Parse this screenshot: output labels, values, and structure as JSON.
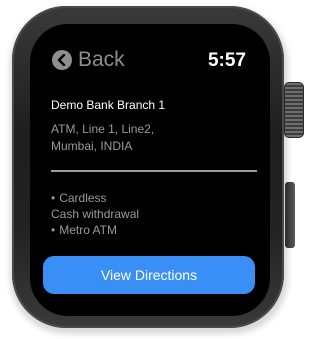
{
  "header": {
    "back_label": "Back",
    "time": "5:57"
  },
  "branch": {
    "name": "Demo Bank Branch 1",
    "address_line_1": "ATM, Line 1, Line2,",
    "address_line_2": "Mumbai, INDIA"
  },
  "features": [
    {
      "bullet": "•",
      "lines": [
        "Cardless",
        "Cash withdrawal"
      ]
    },
    {
      "bullet": "•",
      "lines": [
        "Metro ATM"
      ]
    }
  ],
  "actions": {
    "directions_label": "View Directions"
  },
  "colors": {
    "accent": "#3a8ff7",
    "screen": "#000000",
    "muted_text": "#9a9a9a"
  },
  "icons": {
    "back": "chevron-left-circle-icon"
  }
}
